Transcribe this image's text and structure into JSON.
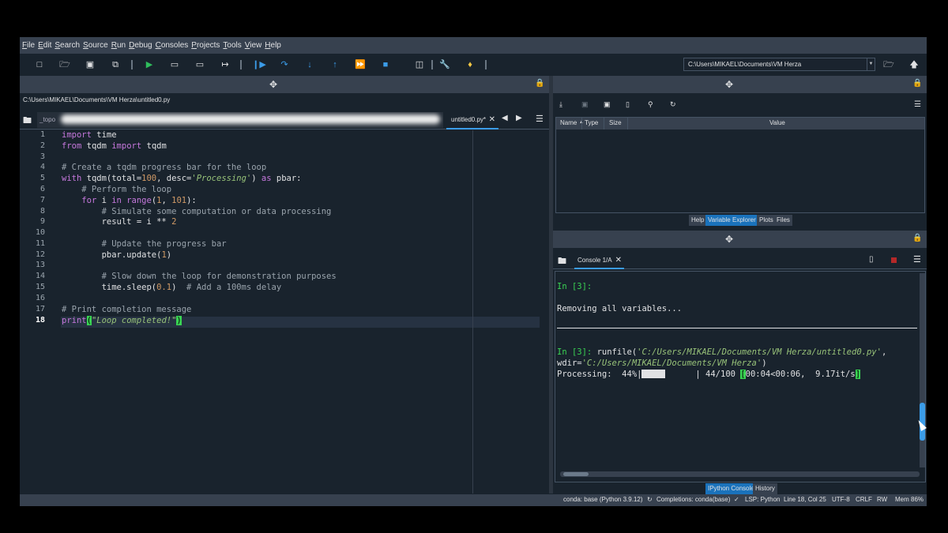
{
  "menu": [
    "File",
    "Edit",
    "Search",
    "Source",
    "Run",
    "Debug",
    "Consoles",
    "Projects",
    "Tools",
    "View",
    "Help"
  ],
  "toolbar": {
    "working_dir": "C:\\Users\\MIKAEL\\Documents\\VM Herza"
  },
  "editor": {
    "file_path": "C:\\Users\\MIKAEL\\Documents\\VM Herza\\untitled0.py",
    "blurred_tab_label": "_topo",
    "active_tab": "untitled0.py*",
    "line_numbers": [
      "1",
      "2",
      "3",
      "4",
      "5",
      "6",
      "7",
      "8",
      "9",
      "10",
      "11",
      "12",
      "13",
      "14",
      "15",
      "16",
      "17",
      "18"
    ],
    "code": {
      "l1_kw": "import",
      "l1_rest": " time",
      "l2_kw1": "from",
      "l2_mid": " tqdm ",
      "l2_kw2": "import",
      "l2_rest": " tqdm",
      "l4": "# Create a tqdm progress bar for the loop",
      "l5_kw": "with",
      "l5_a": " tqdm(total=",
      "l5_num": "100",
      "l5_b": ", desc=",
      "l5_str": "'Processing'",
      "l5_c": ") ",
      "l5_kw2": "as",
      "l5_d": " pbar:",
      "l6": "    # Perform the loop",
      "l7_indent": "    ",
      "l7_kw": "for",
      "l7_a": " i ",
      "l7_kw2": "in",
      "l7_sp": " ",
      "l7_fn": "range",
      "l7_b": "(",
      "l7_n1": "1",
      "l7_c": ", ",
      "l7_n2": "101",
      "l7_d": "):",
      "l8": "        # Simulate some computation or data processing",
      "l9_a": "        result = i ** ",
      "l9_num": "2",
      "l11": "        # Update the progress bar",
      "l12_a": "        pbar.update(",
      "l12_num": "1",
      "l12_b": ")",
      "l14": "        # Slow down the loop for demonstration purposes",
      "l15_a": "        time.sleep(",
      "l15_num": "0.1",
      "l15_b": ")  ",
      "l15_cm": "# Add a 100ms delay",
      "l17": "# Print completion message",
      "l18_fn": "print",
      "l18_p1": "(",
      "l18_str": "\"Loop completed!\"",
      "l18_p2": ")"
    }
  },
  "variable_explorer": {
    "columns": [
      "Name",
      "Type",
      "Size",
      "Value"
    ],
    "tabs": [
      "Help",
      "Variable Explorer",
      "Plots",
      "Files"
    ]
  },
  "console": {
    "tab_label": "Console 1/A",
    "prompt1": "In [3]:",
    "removing": "Removing all variables...",
    "prompt2": "In [3]:",
    "runfile_a": " runfile(",
    "runfile_path": "'C:/Users/MIKAEL/Documents/VM Herza/untitled0.py'",
    "runfile_b": ",",
    "wdir_a": "wdir=",
    "wdir_path": "'C:/Users/MIKAEL/Documents/VM Herza'",
    "wdir_b": ")",
    "progress_prefix": "Processing:  44%|",
    "progress_fraction": 0.44,
    "progress_suffix_a": "      | 44/100 ",
    "progress_bracket_open": "[",
    "progress_time": "00:04<00:06,  9.17it/s",
    "progress_bracket_close": "]",
    "tabs": [
      "IPython Console",
      "History"
    ]
  },
  "statusbar": {
    "conda": "conda: base (Python 3.9.12)",
    "completions": "Completions: conda(base)",
    "lsp": "LSP: Python",
    "position": "Line 18, Col 25",
    "encoding": "UTF-8",
    "eol": "CRLF",
    "rw": "RW",
    "mem": "Mem 86%"
  },
  "colors": {
    "background": "#19232d",
    "panel": "#37414f",
    "accent": "#3b9ce8",
    "prompt_green": "#39d353"
  }
}
